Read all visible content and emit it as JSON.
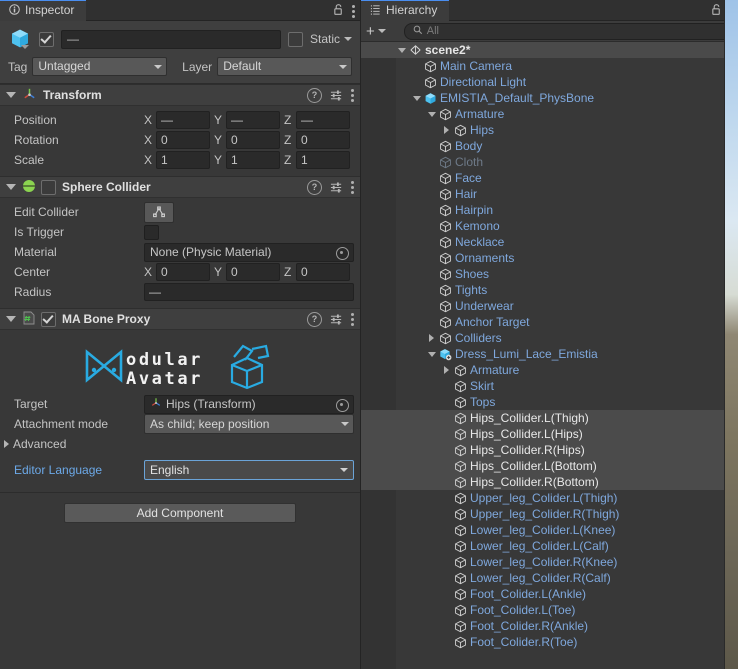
{
  "inspector": {
    "tab_label": "Inspector",
    "tab_icon": "info-icon",
    "lock_icon": "lock-open-icon",
    "menu_icon": "kebab-menu-icon",
    "game_object": {
      "enabled": true,
      "name_value": "—",
      "static_label": "Static",
      "tag_label": "Tag",
      "tag_value": "Untagged",
      "layer_label": "Layer",
      "layer_value": "Default"
    },
    "components": [
      {
        "title": "Transform",
        "icon": "transform-axis-icon",
        "rows": [
          {
            "label": "Position",
            "x": "—",
            "y": "—",
            "z": "—"
          },
          {
            "label": "Rotation",
            "x": "0",
            "y": "0",
            "z": "0"
          },
          {
            "label": "Scale",
            "x": "1",
            "y": "1",
            "z": "1"
          }
        ]
      },
      {
        "title": "Sphere Collider",
        "icon": "sphere-collider-icon",
        "edit_collider_label": "Edit Collider",
        "is_trigger_label": "Is Trigger",
        "material_label": "Material",
        "material_value": "None (Physic Material)",
        "center_label": "Center",
        "center": {
          "x": "0",
          "y": "0",
          "z": "0"
        },
        "radius_label": "Radius",
        "radius_value": "—"
      },
      {
        "title": "MA Bone Proxy",
        "icon": "csharp-script-icon",
        "enabled": true,
        "logo_text_primary": "Modular",
        "logo_text_secondary": "Avatar",
        "target_label": "Target",
        "target_value": "Hips (Transform)",
        "attachment_label": "Attachment mode",
        "attachment_value": "As child; keep position",
        "advanced_label": "Advanced",
        "editor_language_label": "Editor Language",
        "editor_language_value": "English"
      }
    ],
    "add_component_label": "Add Component",
    "axis_labels": {
      "x": "X",
      "y": "Y",
      "z": "Z"
    }
  },
  "hierarchy": {
    "tab_label": "Hierarchy",
    "tab_icon": "hierarchy-list-icon",
    "lock_icon": "lock-open-icon",
    "menu_icon": "kebab-menu-icon",
    "add_button_label": "+",
    "search_placeholder": "All",
    "search_icon": "search-icon",
    "items": [
      {
        "label": "scene2*",
        "depth": 0,
        "tri": "down",
        "icon": "scene-icon",
        "style": "scene",
        "kebab": true
      },
      {
        "label": "Main Camera",
        "depth": 1,
        "tri": "none",
        "icon": "gameobject-icon",
        "style": "prefab"
      },
      {
        "label": "Directional Light",
        "depth": 1,
        "tri": "none",
        "icon": "gameobject-icon",
        "style": "prefab"
      },
      {
        "label": "EMISTIA_Default_PhysBone",
        "depth": 1,
        "tri": "down",
        "icon": "prefab-icon",
        "style": "prefab",
        "arrow": true
      },
      {
        "label": "Armature",
        "depth": 2,
        "tri": "down",
        "icon": "gameobject-icon",
        "style": "prefab"
      },
      {
        "label": "Hips",
        "depth": 3,
        "tri": "right",
        "icon": "gameobject-icon",
        "style": "prefab"
      },
      {
        "label": "Body",
        "depth": 2,
        "tri": "none",
        "icon": "gameobject-icon",
        "style": "prefab"
      },
      {
        "label": "Cloth",
        "depth": 2,
        "tri": "none",
        "icon": "gameobject-icon",
        "style": "dim"
      },
      {
        "label": "Face",
        "depth": 2,
        "tri": "none",
        "icon": "gameobject-icon",
        "style": "prefab"
      },
      {
        "label": "Hair",
        "depth": 2,
        "tri": "none",
        "icon": "gameobject-icon",
        "style": "prefab"
      },
      {
        "label": "Hairpin",
        "depth": 2,
        "tri": "none",
        "icon": "gameobject-icon",
        "style": "prefab"
      },
      {
        "label": "Kemono",
        "depth": 2,
        "tri": "none",
        "icon": "gameobject-icon",
        "style": "prefab"
      },
      {
        "label": "Necklace",
        "depth": 2,
        "tri": "none",
        "icon": "gameobject-icon",
        "style": "prefab"
      },
      {
        "label": "Ornaments",
        "depth": 2,
        "tri": "none",
        "icon": "gameobject-icon",
        "style": "prefab"
      },
      {
        "label": "Shoes",
        "depth": 2,
        "tri": "none",
        "icon": "gameobject-icon",
        "style": "prefab"
      },
      {
        "label": "Tights",
        "depth": 2,
        "tri": "none",
        "icon": "gameobject-icon",
        "style": "prefab"
      },
      {
        "label": "Underwear",
        "depth": 2,
        "tri": "none",
        "icon": "gameobject-icon",
        "style": "prefab"
      },
      {
        "label": "Anchor Target",
        "depth": 2,
        "tri": "none",
        "icon": "gameobject-icon",
        "style": "prefab"
      },
      {
        "label": "Colliders",
        "depth": 2,
        "tri": "right",
        "icon": "gameobject-icon",
        "style": "prefab"
      },
      {
        "label": "Dress_Lumi_Lace_Emistia",
        "depth": 2,
        "tri": "down",
        "icon": "prefab-variant-icon",
        "style": "prefab",
        "arrow": true
      },
      {
        "label": "Armature",
        "depth": 3,
        "tri": "right",
        "icon": "gameobject-icon",
        "style": "prefab"
      },
      {
        "label": "Skirt",
        "depth": 3,
        "tri": "none",
        "icon": "gameobject-icon",
        "style": "prefab"
      },
      {
        "label": "Tops",
        "depth": 3,
        "tri": "none",
        "icon": "gameobject-icon",
        "style": "prefab"
      },
      {
        "label": "Hips_Collider.L(Thigh)",
        "depth": 3,
        "tri": "none",
        "icon": "gameobject-icon",
        "style": "selected"
      },
      {
        "label": "Hips_Collider.L(Hips)",
        "depth": 3,
        "tri": "none",
        "icon": "gameobject-icon",
        "style": "selected"
      },
      {
        "label": "Hips_Collider.R(Hips)",
        "depth": 3,
        "tri": "none",
        "icon": "gameobject-icon",
        "style": "selected"
      },
      {
        "label": "Hips_Collider.L(Bottom)",
        "depth": 3,
        "tri": "none",
        "icon": "gameobject-icon",
        "style": "selected"
      },
      {
        "label": "Hips_Collider.R(Bottom)",
        "depth": 3,
        "tri": "none",
        "icon": "gameobject-icon",
        "style": "selected"
      },
      {
        "label": "Upper_leg_Colider.L(Thigh)",
        "depth": 3,
        "tri": "none",
        "icon": "gameobject-icon",
        "style": "prefab"
      },
      {
        "label": "Upper_leg_Colider.R(Thigh)",
        "depth": 3,
        "tri": "none",
        "icon": "gameobject-icon",
        "style": "prefab"
      },
      {
        "label": "Lower_leg_Colider.L(Knee)",
        "depth": 3,
        "tri": "none",
        "icon": "gameobject-icon",
        "style": "prefab"
      },
      {
        "label": "Lower_leg_Colider.L(Calf)",
        "depth": 3,
        "tri": "none",
        "icon": "gameobject-icon",
        "style": "prefab"
      },
      {
        "label": "Lower_leg_Colider.R(Knee)",
        "depth": 3,
        "tri": "none",
        "icon": "gameobject-icon",
        "style": "prefab"
      },
      {
        "label": "Lower_leg_Colider.R(Calf)",
        "depth": 3,
        "tri": "none",
        "icon": "gameobject-icon",
        "style": "prefab"
      },
      {
        "label": "Foot_Colider.L(Ankle)",
        "depth": 3,
        "tri": "none",
        "icon": "gameobject-icon",
        "style": "prefab"
      },
      {
        "label": "Foot_Colider.L(Toe)",
        "depth": 3,
        "tri": "none",
        "icon": "gameobject-icon",
        "style": "prefab"
      },
      {
        "label": "Foot_Colider.R(Ankle)",
        "depth": 3,
        "tri": "none",
        "icon": "gameobject-icon",
        "style": "prefab"
      },
      {
        "label": "Foot_Colider.R(Toe)",
        "depth": 3,
        "tri": "none",
        "icon": "gameobject-icon",
        "style": "prefab"
      }
    ]
  },
  "colors": {
    "accent_blue": "#4a8ef0",
    "prefab_blue": "#7fa8dd",
    "link_blue": "#6ca9e8",
    "panel_bg": "#383838",
    "header_bg": "#3f3f3f",
    "ma_logo_blue": "#29abe2",
    "selection_bg": "#4b4b4b"
  }
}
